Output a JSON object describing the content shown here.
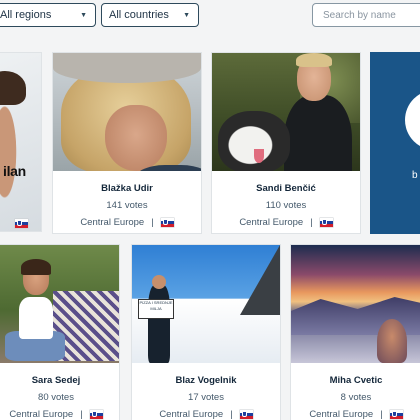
{
  "filters": {
    "regions_label": "All regions",
    "countries_label": "All countries",
    "search_placeholder": "Search by name"
  },
  "row1": [
    {
      "partial_text": "ilan"
    },
    {
      "name": "Blažka Udir",
      "votes": "141 votes",
      "region": "Central Europe"
    },
    {
      "name": "Sandi Benčić",
      "votes": "110 votes",
      "region": "Central Europe"
    },
    {
      "partial_text": "b"
    }
  ],
  "row2": [
    {
      "name": "Sara Sedej",
      "votes": "80 votes",
      "region": "Central Europe"
    },
    {
      "name": "Blaz Vogelnik",
      "votes": "17 votes",
      "region": "Central Europe",
      "sign_text": "PIZZA I SREDNJE MILJA"
    },
    {
      "name": "Miha Cvetic",
      "votes": "8 votes",
      "region": "Central Europe"
    }
  ],
  "separator": "|"
}
